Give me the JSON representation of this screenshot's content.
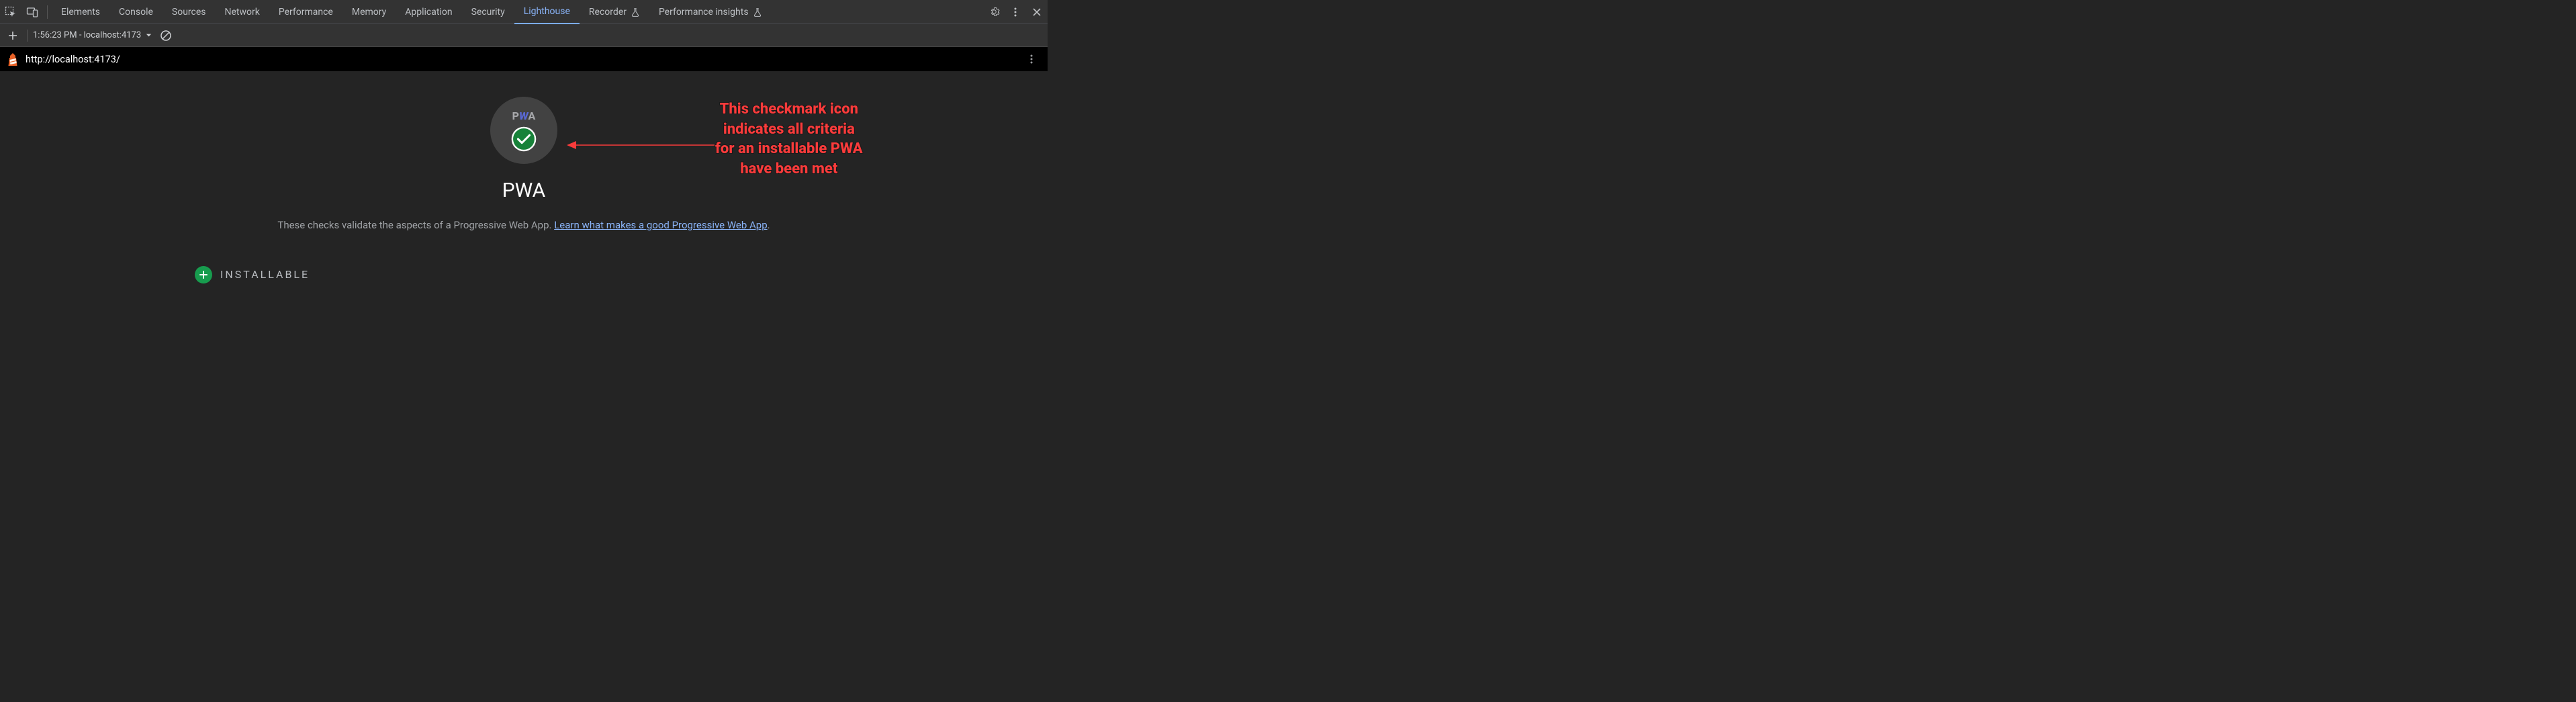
{
  "topbar": {
    "tabs": [
      "Elements",
      "Console",
      "Sources",
      "Network",
      "Performance",
      "Memory",
      "Application",
      "Security",
      "Lighthouse",
      "Recorder",
      "Performance insights"
    ],
    "active_index": 8,
    "flask_indices": [
      9,
      10
    ]
  },
  "toolbar2": {
    "report_label": "1:56:23 PM - localhost:4173"
  },
  "urlbar": {
    "url": "http://localhost:4173/"
  },
  "pwa": {
    "title": "PWA",
    "desc_prefix": "These checks validate the aspects of a Progressive Web App. ",
    "link_text": "Learn what makes a good Progressive Web App",
    "desc_suffix": "."
  },
  "section": {
    "installable_label": "INSTALLABLE"
  },
  "annotation": {
    "line1": "This checkmark icon",
    "line2": "indicates all criteria",
    "line3": "for an installable PWA",
    "line4": "have been met"
  }
}
